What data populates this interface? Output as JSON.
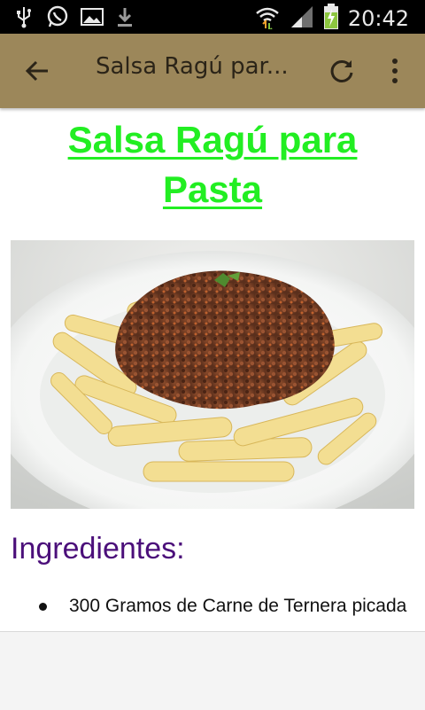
{
  "status_bar": {
    "time": "20:42",
    "icons": [
      "usb-icon",
      "whatsapp-icon",
      "image-icon",
      "download-icon",
      "wifi-icon",
      "signal-icon",
      "battery-charging-icon"
    ]
  },
  "app_bar": {
    "title": "Salsa Ragú par...",
    "background": "#9c875a"
  },
  "recipe": {
    "title_line1": "Salsa Ragú para",
    "title_line2": "Pasta",
    "title_color": "#22ee22",
    "image_alt": "Pasta con salsa ragú",
    "ingredients_heading": "Ingredientes:",
    "heading_color": "#4b0f7a",
    "ingredients": [
      "300 Gramos de Carne de Ternera picada"
    ]
  }
}
